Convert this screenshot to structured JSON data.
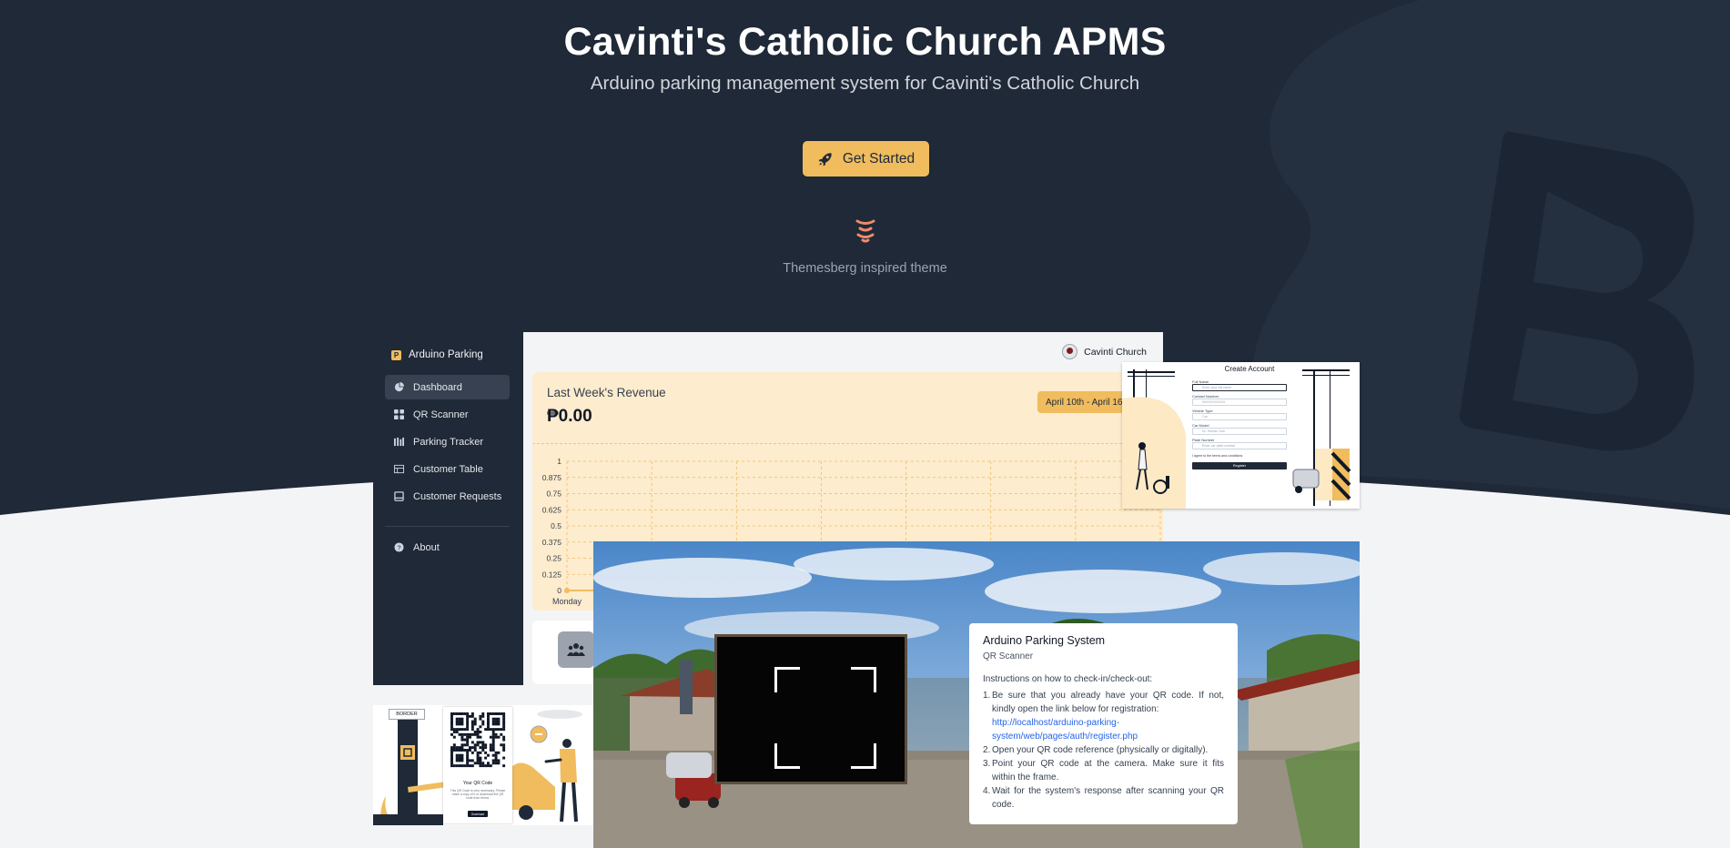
{
  "hero": {
    "title": "Cavinti's Catholic Church APMS",
    "subtitle": "Arduino parking management system for Cavinti's Catholic Church",
    "cta_label": "Get Started",
    "cta_icon": "rocket-icon",
    "brand_icon": "themesberg-logo-icon",
    "brand_caption": "Themesberg inspired theme"
  },
  "colors": {
    "hero_bg": "#1f2937",
    "accent": "#f0bc5e",
    "page_bg": "#f3f4f6"
  },
  "sidebar": {
    "brand": "Arduino Parking",
    "items": [
      {
        "label": "Dashboard",
        "icon": "pie-chart-icon",
        "active": true
      },
      {
        "label": "QR Scanner",
        "icon": "grid-icon"
      },
      {
        "label": "Parking Tracker",
        "icon": "parking-bars-icon"
      },
      {
        "label": "Customer Table",
        "icon": "table-icon"
      },
      {
        "label": "Customer Requests",
        "icon": "inbox-icon"
      },
      {
        "label": "About",
        "icon": "question-circle-icon"
      }
    ]
  },
  "topbar": {
    "user_name": "Cavinti Church"
  },
  "revenue": {
    "title": "Last Week's Revenue",
    "value": "₱0.00",
    "date_range": "April 10th - April 16th"
  },
  "chart_data": {
    "type": "line",
    "title": "",
    "categories": [
      "Monday"
    ],
    "y_ticks": [
      "1",
      "0.875",
      "0.75",
      "0.625",
      "0.5",
      "0.375",
      "0.25",
      "0.125",
      "0"
    ],
    "ylim": [
      0,
      1
    ],
    "series": [
      {
        "values": [
          0
        ]
      }
    ],
    "grid": true
  },
  "register": {
    "title": "Create Account",
    "fields": [
      {
        "label": "Full Name",
        "placeholder": "Enter your full name"
      },
      {
        "label": "Contact Number",
        "placeholder": "09XXXXXXXXX"
      },
      {
        "label": "Vehicle Type",
        "placeholder": "Car"
      },
      {
        "label": "Car Model",
        "placeholder": "ex. Honda Civic"
      },
      {
        "label": "Plate Number",
        "placeholder": "Enter car plate number"
      }
    ],
    "terms": "I agree to the terms and conditions",
    "button": "Register"
  },
  "scanner": {
    "title": "Arduino Parking System",
    "subtitle": "QR Scanner",
    "intro": "Instructions on how to check-in/check-out:",
    "steps": [
      {
        "num": "1.",
        "text": "Be sure that you already have your QR code. If not, kindly open the link below for registration:",
        "link": "http://localhost/arduino-parking-system/web/pages/auth/register.php"
      },
      {
        "num": "2.",
        "text": "Open your QR code reference (physically or digitally)."
      },
      {
        "num": "3.",
        "text": "Point your QR code at the camera. Make sure it fits within the frame."
      },
      {
        "num": "4.",
        "text": "Wait for the system's response after scanning your QR code."
      }
    ]
  },
  "qr_card": {
    "border_label": "BORDER",
    "caption": "Your QR Code",
    "text": "This QR Code is very necessary. Please make a copy of it or download the QR code from below.",
    "button": "Download"
  }
}
